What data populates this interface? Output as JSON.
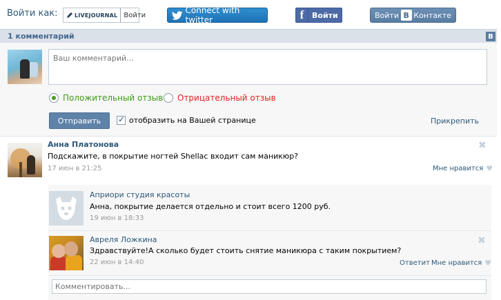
{
  "login": {
    "label": "Войти как:",
    "livejournal_logo": "LIVEJOURNAL",
    "livejournal_login": "Войти",
    "twitter_label": "Connect with twitter",
    "facebook_label": "Войти",
    "vk_login": "Войти",
    "vk_contact": "Контакте",
    "vk_logo_letter": "В"
  },
  "comments_header": {
    "count_label": "1 комментарий",
    "corner_logo": "В"
  },
  "composer": {
    "placeholder": "Ваш комментарий...",
    "positive_label": "Положительный отзыв",
    "negative_label": "Отрицательный отзыв",
    "send_label": "Отправить",
    "show_on_page_label": "отобразить на Вашей странице",
    "attach_label": "Прикрепить"
  },
  "comments": [
    {
      "author": "Анна Платонова",
      "text": "Подскажите, в покрытие ногтей Shellac входит сам маникюр?",
      "date": "17 июн в 21:25",
      "like_label": "Мне нравится",
      "replies": [
        {
          "author": "Априори студия красоты",
          "text": "Анна, покрытие делается отдельно и стоит всего 1200 руб.",
          "date": "19 июн в 18:33"
        },
        {
          "author": "Авреля Ложкина",
          "text": "Здравствуйте!А сколько будет стоить снятие маникюра с таким покрытием?",
          "date": "22 июн в 14:40",
          "reply_label": "Ответит",
          "like_label": "Мне нравится"
        }
      ],
      "reply_placeholder": "Комментировать..."
    }
  ],
  "colors": {
    "link": "#2b587a",
    "header_bg": "#dae1e8",
    "button_bg": "#5e82a8",
    "positive": "#3e9a1a",
    "negative": "#dd2222"
  },
  "icons": [
    "twitter-bird-icon",
    "facebook-f-icon",
    "vk-logo-icon",
    "close-icon",
    "heart-icon",
    "check-icon",
    "deactivated-dog-icon"
  ]
}
